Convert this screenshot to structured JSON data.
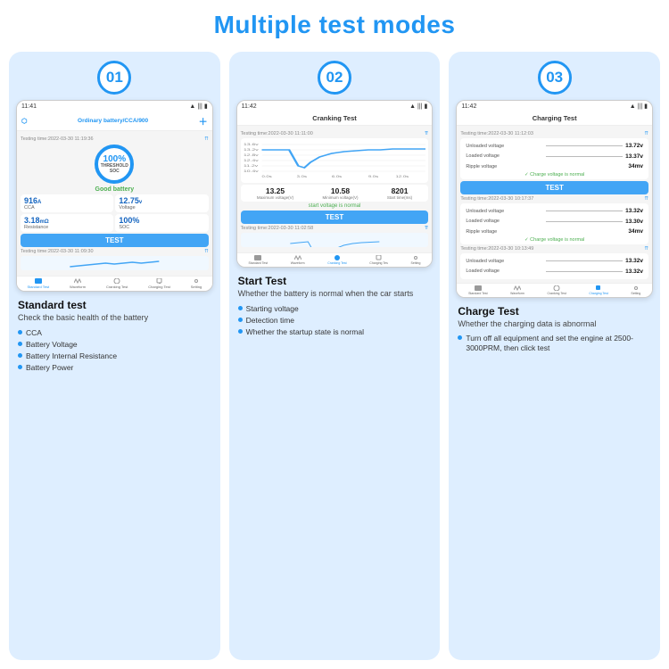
{
  "title": "Multiple test modes",
  "cards": [
    {
      "number": "01",
      "phone": {
        "time": "11:41",
        "header_label": "Ordinary battery/CCA/900",
        "testing_time": "Testing time:2022-03-30 11:19:36",
        "battery_pct": "100%",
        "battery_sublabel": "THRESHOLD SOC",
        "good_label": "Good battery",
        "stats": [
          {
            "val": "916",
            "unit": "A",
            "label": "CCA"
          },
          {
            "val": "12.75",
            "unit": "v",
            "label": "Voltage"
          },
          {
            "val": "3.18",
            "unit": "mΩ",
            "label": "Resistance"
          },
          {
            "val": "100%",
            "unit": "",
            "label": "SOC"
          }
        ],
        "test_btn": "TEST",
        "testing_time2": "Testing time:2022-03-30 11:09:30",
        "nav": [
          "Standard Test",
          "Waveform",
          "Cranking Test",
          "Charging Test",
          "Setting"
        ]
      },
      "title": "Standard test",
      "subtitle": "Check the basic health of the battery",
      "bullets": [
        "CCA",
        "Battery Voltage",
        "Battery Internal Resistance",
        "Battery Power"
      ]
    },
    {
      "number": "02",
      "phone": {
        "time": "11:42",
        "header_label": "Cranking Test",
        "testing_time": "Testing time:2022-03-30 11:11:00",
        "normal_label": "start voltage is normal",
        "stats": [
          {
            "val": "13.25",
            "label": "Maximum voltage(V)"
          },
          {
            "val": "10.58",
            "label": "Minimum voltage(V)"
          },
          {
            "val": "8201",
            "label": "Start time(ms)"
          }
        ],
        "test_btn": "TEST",
        "testing_time2": "Testing time:2022-03-30 11:02:58",
        "nav": [
          "Standard Test",
          "Waveform",
          "Cranking Test",
          "Charging Tes",
          "Setting"
        ]
      },
      "title": "Start Test",
      "subtitle": "Whether the battery is normal when the car starts",
      "bullets": [
        "Starting voltage",
        "Detection time",
        "Whether the startup state is normal"
      ]
    },
    {
      "number": "03",
      "phone": {
        "time": "11:42",
        "header_label": "Charging Test",
        "testing_time": "Testing time:2022-03-30 11:12:03",
        "charge_rows": [
          {
            "label": "Unloaded voltage",
            "val": "13.72v"
          },
          {
            "label": "Loaded voltage",
            "val": "13.37v"
          },
          {
            "label": "Ripple voltage",
            "val": "34mv"
          }
        ],
        "normal_label": "Charge voltage is normal",
        "test_btn": "TEST",
        "history1": {
          "time": "Testing time:2022-03-30 10:17:37",
          "rows": [
            {
              "label": "Unloaded voltage",
              "val": "13.32v"
            },
            {
              "label": "Loaded voltage",
              "val": "13.30v"
            },
            {
              "label": "Ripple voltage",
              "val": "34mv"
            }
          ],
          "normal_label": "Charge voltage is normal"
        },
        "history2": {
          "time": "Testing time:2022-03-30 10:13:49",
          "rows": [
            {
              "label": "Unloaded voltage",
              "val": "13.32v"
            },
            {
              "label": "Loaded voltage",
              "val": "13.32v"
            }
          ]
        },
        "nav": [
          "Standard Test",
          "Waveform",
          "Cranking Test",
          "Charging Test",
          "Setting"
        ]
      },
      "title": "Charge Test",
      "subtitle": "Whether the charging data is abnormal",
      "bullets": [
        "Turn off all equipment and set the engine at 2500-3000PRM, then click test"
      ]
    }
  ]
}
